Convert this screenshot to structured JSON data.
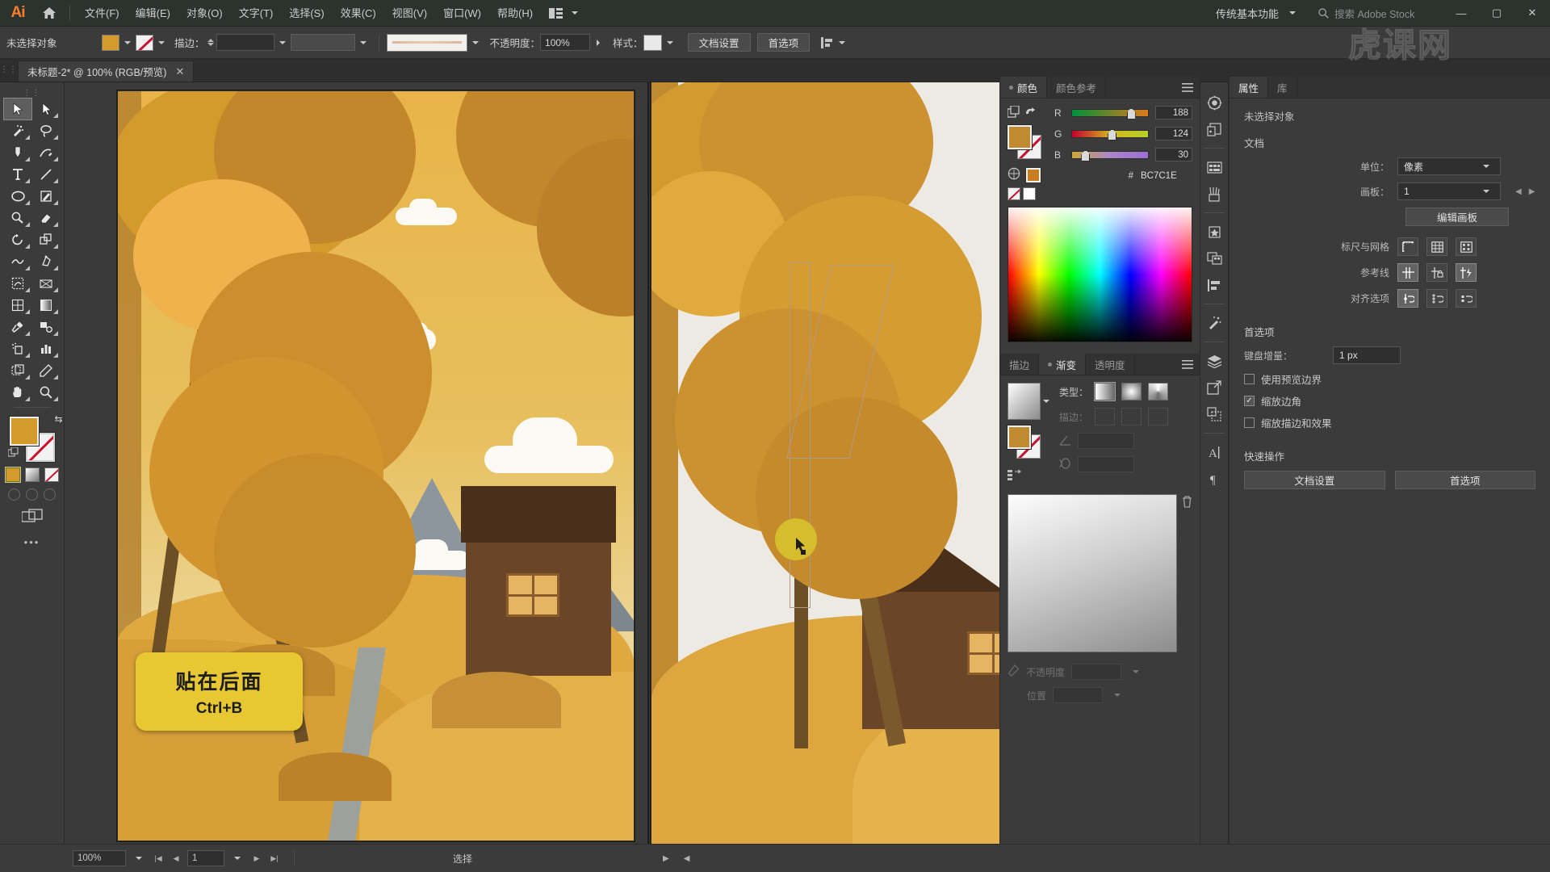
{
  "app": {
    "name": "Ai",
    "logo_text": "Ai"
  },
  "menubar": {
    "items": [
      {
        "label": "文件(F)"
      },
      {
        "label": "编辑(E)"
      },
      {
        "label": "对象(O)"
      },
      {
        "label": "文字(T)"
      },
      {
        "label": "选择(S)"
      },
      {
        "label": "效果(C)"
      },
      {
        "label": "视图(V)"
      },
      {
        "label": "窗口(W)"
      },
      {
        "label": "帮助(H)"
      }
    ],
    "workspace": "传统基本功能",
    "search_placeholder": "搜索 Adobe Stock",
    "window_controls": [
      "—",
      "▢",
      "✕"
    ]
  },
  "optionsbar": {
    "selection_status": "未选择对象",
    "stroke_label": "描边：",
    "stroke_weight": "",
    "opacity_label": "不透明度：",
    "opacity_value": "100%",
    "style_label": "样式：",
    "doc_setup": "文档设置",
    "preferences": "首选项"
  },
  "doctab": {
    "title": "未标题-2* @ 100% (RGB/预览)",
    "close": "✕"
  },
  "toolbar": {
    "tools": [
      {
        "name": "selection-tool",
        "active": true
      },
      {
        "name": "direct-selection-tool",
        "active": false
      },
      {
        "name": "magic-wand-tool",
        "active": false
      },
      {
        "name": "lasso-tool",
        "active": false
      },
      {
        "name": "pen-tool",
        "active": false
      },
      {
        "name": "curvature-tool",
        "active": false
      },
      {
        "name": "type-tool",
        "active": false
      },
      {
        "name": "line-segment-tool",
        "active": false
      },
      {
        "name": "ellipse-tool",
        "active": false
      },
      {
        "name": "paintbrush-tool",
        "active": false
      },
      {
        "name": "shaper-tool",
        "active": false
      },
      {
        "name": "eraser-tool",
        "active": false
      },
      {
        "name": "rotate-tool",
        "active": false
      },
      {
        "name": "scale-tool",
        "active": false
      },
      {
        "name": "width-tool",
        "active": false
      },
      {
        "name": "free-transform-tool",
        "active": false
      },
      {
        "name": "shape-builder-tool",
        "active": false
      },
      {
        "name": "perspective-grid-tool",
        "active": false
      },
      {
        "name": "mesh-tool",
        "active": false
      },
      {
        "name": "gradient-tool",
        "active": false
      },
      {
        "name": "eyedropper-tool",
        "active": false
      },
      {
        "name": "blend-tool",
        "active": false
      },
      {
        "name": "symbol-sprayer-tool",
        "active": false
      },
      {
        "name": "column-graph-tool",
        "active": false
      },
      {
        "name": "artboard-tool",
        "active": false
      },
      {
        "name": "slice-tool",
        "active": false
      },
      {
        "name": "hand-tool",
        "active": false
      },
      {
        "name": "zoom-tool",
        "active": false
      }
    ],
    "fill_color": "#D49A2C",
    "stroke_color": "none"
  },
  "callout": {
    "title": "贴在后面",
    "shortcut": "Ctrl+B",
    "bg": "#E8C832"
  },
  "color_panel": {
    "tabs": [
      {
        "label": "颜色",
        "active": true
      },
      {
        "label": "颜色参考",
        "active": false
      }
    ],
    "channels": [
      {
        "label": "R",
        "value": "188",
        "pos": 72
      },
      {
        "label": "G",
        "value": "124",
        "pos": 47
      },
      {
        "label": "B",
        "value": "30",
        "pos": 12
      }
    ],
    "hex_prefix": "#",
    "hex": "BC7C1E",
    "fill_color": "#BC7C1E"
  },
  "gradient_panel": {
    "tabs": [
      {
        "label": "描边",
        "active": false
      },
      {
        "label": "渐变",
        "active": true
      },
      {
        "label": "透明度",
        "active": false
      }
    ],
    "type_label": "类型：",
    "stroke_label": "描边：",
    "opacity_label": "不透明度",
    "location_label": "位置"
  },
  "properties_panel": {
    "tabs": [
      {
        "label": "属性",
        "active": true
      },
      {
        "label": "库",
        "active": false
      }
    ],
    "no_selection": "未选择对象",
    "document_title": "文档",
    "unit_label": "单位：",
    "unit_value": "像素",
    "artboard_label": "画板：",
    "artboard_value": "1",
    "edit_artboard": "编辑画板",
    "rulers_grid_label": "标尺与网格",
    "guides_label": "参考线",
    "align_label": "对齐选项",
    "prefs_title": "首选项",
    "keyboard_increment_label": "键盘增量：",
    "keyboard_increment_value": "1 px",
    "checkboxes": [
      {
        "label": "使用预览边界",
        "checked": false
      },
      {
        "label": "缩放边角",
        "checked": true
      },
      {
        "label": "缩放描边和效果",
        "checked": false
      }
    ],
    "quick_actions_title": "快速操作",
    "quick_actions": [
      {
        "label": "文档设置"
      },
      {
        "label": "首选项"
      }
    ]
  },
  "panel_rail": {
    "icons": [
      "color-panel-icon",
      "color-guide-icon",
      "swatches-icon",
      "brushes-icon",
      "symbols-icon",
      "artboards-icon",
      "align-icon",
      "magic-wand-panel-icon",
      "layers-icon",
      "export-icon",
      "pathfinder-icon",
      "character-icon",
      "paragraph-icon"
    ]
  },
  "statusbar": {
    "zoom": "100%",
    "page": "1",
    "tool_name": "选择"
  },
  "watermark": {
    "text": "虎课网"
  },
  "canvas": {
    "artboard1_name": "artboard-left",
    "artboard2_name": "artboard-right-selected",
    "cursor_tooltip": "贴在后面 Ctrl+B"
  }
}
